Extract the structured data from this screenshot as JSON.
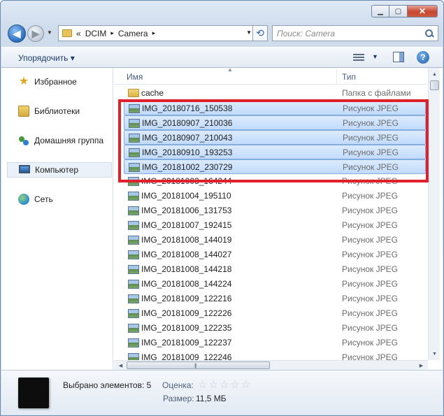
{
  "window": {
    "minimize_icon": "minimize-icon",
    "maximize_icon": "maximize-icon",
    "close_icon": "close-icon"
  },
  "address_bar": {
    "overflow": "«",
    "segments": [
      "DCIM",
      "Camera"
    ],
    "separator": "▸"
  },
  "search": {
    "placeholder": "Поиск: Camera"
  },
  "toolbar": {
    "organize": "Упорядочить ▾"
  },
  "nav": {
    "items": [
      {
        "label": "Избранное",
        "icon": "star-icon"
      },
      {
        "label": "Библиотеки",
        "icon": "library-icon"
      },
      {
        "label": "Домашняя группа",
        "icon": "homegroup-icon"
      },
      {
        "label": "Компьютер",
        "icon": "computer-icon",
        "selected": true
      },
      {
        "label": "Сеть",
        "icon": "network-icon"
      }
    ]
  },
  "columns": {
    "name": "Имя",
    "type": "Тип"
  },
  "files": [
    {
      "name": "cache",
      "type": "Папка с файлами",
      "folder": true,
      "selected": false
    },
    {
      "name": "IMG_20180716_150538",
      "type": "Рисунок JPEG",
      "selected": true
    },
    {
      "name": "IMG_20180907_210036",
      "type": "Рисунок JPEG",
      "selected": true
    },
    {
      "name": "IMG_20180907_210043",
      "type": "Рисунок JPEG",
      "selected": true
    },
    {
      "name": "IMG_20180910_193253",
      "type": "Рисунок JPEG",
      "selected": true
    },
    {
      "name": "IMG_20181002_230729",
      "type": "Рисунок JPEG",
      "selected": true
    },
    {
      "name": "IMG_20181003_164244",
      "type": "Рисунок JPEG",
      "selected": false
    },
    {
      "name": "IMG_20181004_195110",
      "type": "Рисунок JPEG",
      "selected": false
    },
    {
      "name": "IMG_20181006_131753",
      "type": "Рисунок JPEG",
      "selected": false
    },
    {
      "name": "IMG_20181007_192415",
      "type": "Рисунок JPEG",
      "selected": false
    },
    {
      "name": "IMG_20181008_144019",
      "type": "Рисунок JPEG",
      "selected": false
    },
    {
      "name": "IMG_20181008_144027",
      "type": "Рисунок JPEG",
      "selected": false
    },
    {
      "name": "IMG_20181008_144218",
      "type": "Рисунок JPEG",
      "selected": false
    },
    {
      "name": "IMG_20181008_144224",
      "type": "Рисунок JPEG",
      "selected": false
    },
    {
      "name": "IMG_20181009_122216",
      "type": "Рисунок JPEG",
      "selected": false
    },
    {
      "name": "IMG_20181009_122226",
      "type": "Рисунок JPEG",
      "selected": false
    },
    {
      "name": "IMG_20181009_122235",
      "type": "Рисунок JPEG",
      "selected": false
    },
    {
      "name": "IMG_20181009_122237",
      "type": "Рисунок JPEG",
      "selected": false
    },
    {
      "name": "IMG_20181009_122246",
      "type": "Рисунок JPEG",
      "selected": false
    }
  ],
  "details": {
    "selected_text": "Выбрано элементов: 5",
    "rating_label": "Оценка:",
    "rating_stars": 0,
    "size_label": "Размер:",
    "size_value": "11,5 МБ"
  },
  "colors": {
    "highlight_frame": "#e0202a",
    "selection_fill": "#c1dbfc"
  }
}
